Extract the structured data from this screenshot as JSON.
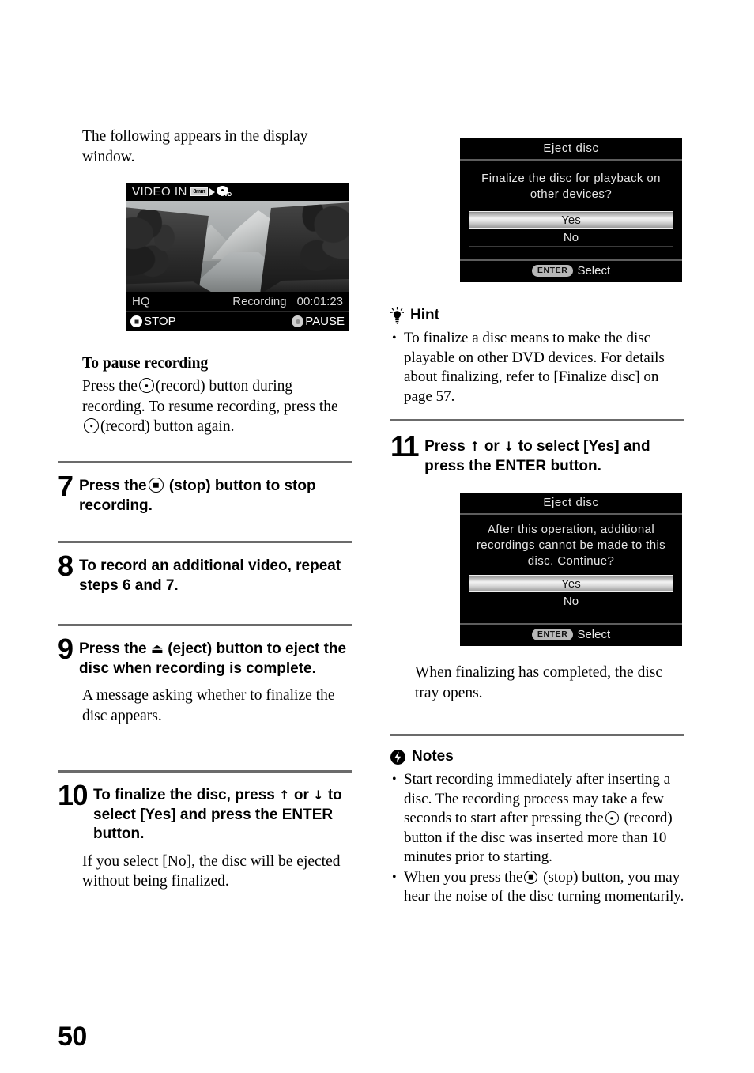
{
  "page": {
    "number": "50"
  },
  "left": {
    "intro": "The following appears in the display window.",
    "display_window": {
      "top_label": "VIDEO  IN",
      "source_icon_label": "8mm",
      "target_icon_label": "DVD",
      "quality": "HQ",
      "status": "Recording",
      "timecode": "00:01:23",
      "button_stop": "STOP",
      "button_pause": "PAUSE"
    },
    "pause_section": {
      "heading": "To pause recording",
      "body_part1": "Press the",
      "body_part2": "(record) button during recording. To resume recording, press the",
      "body_part3": "(record) button again."
    },
    "steps": [
      {
        "number": "7",
        "text_before": "Press the",
        "text_after": "(stop) button to stop recording.",
        "note": ""
      },
      {
        "number": "8",
        "text": "To record an additional video, repeat steps 6 and 7.",
        "note": ""
      },
      {
        "number": "9",
        "text_before": "Press the",
        "eject_glyph": "⏏",
        "text_after": "(eject) button to eject the disc when recording is complete.",
        "note": "A message asking whether to finalize the disc appears."
      },
      {
        "number": "10",
        "text_before": "To finalize the disc, press",
        "up_glyph": "↑",
        "or": "or",
        "down_glyph": "↓",
        "text_after": "to select [Yes] and press the ENTER button.",
        "note": "If you select [No], the disc will be ejected without being finalized."
      }
    ]
  },
  "right": {
    "dialog1": {
      "title": "Eject  disc",
      "message": "Finalize  the  disc  for playback  on  other  devices?",
      "option_yes": "Yes",
      "option_no": "No",
      "footer_badge": "ENTER",
      "footer_label": "Select"
    },
    "hint": {
      "heading": "Hint",
      "items": [
        "To finalize a disc means to make the disc playable on other DVD devices. For details about finalizing, refer to [Finalize disc] on page 57."
      ]
    },
    "step11": {
      "number": "11",
      "text_before": "Press",
      "up_glyph": "↑",
      "or": "or",
      "down_glyph": "↓",
      "text_after": "to select [Yes] and press the ENTER button."
    },
    "dialog2": {
      "title": "Eject  disc",
      "message": "After  this  operation,  additional recordings  cannot  be  made to  this  disc.  Continue?",
      "option_yes": "Yes",
      "option_no": "No",
      "footer_badge": "ENTER",
      "footer_label": "Select"
    },
    "after_dialog2_note": "When finalizing has completed, the disc tray opens.",
    "notes": {
      "heading": "Notes",
      "item1_part1": "Start recording immediately after inserting a disc. The recording process may take a few seconds to start after pressing the",
      "item1_part2": "(record) button if the disc was inserted more than 10 minutes prior to starting.",
      "item2_part1": "When you press the",
      "item2_part2": "(stop) button, you may hear the noise of the disc turning momentarily."
    }
  },
  "colors": {
    "rule": "#6b6b6b",
    "dialog_bg": "#000000",
    "highlight": "#e0e0e0"
  }
}
